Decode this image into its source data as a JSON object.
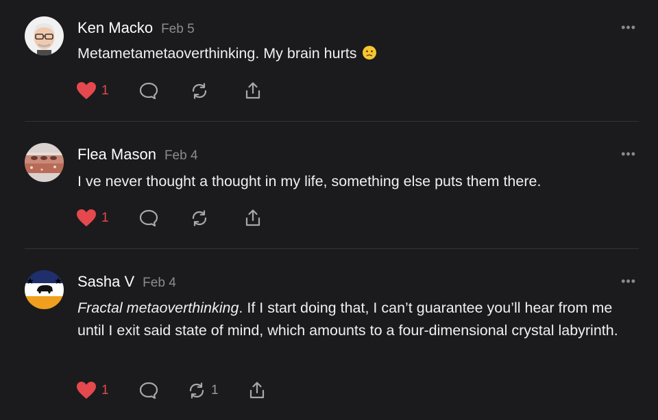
{
  "comments": [
    {
      "author": "Ken Macko",
      "date": "Feb 5",
      "text": "Metametametaoverthinking. My brain hurts",
      "emoji": "🙁",
      "likes": "1",
      "restacks": "",
      "avatar": "cartoon-bald-man-glasses"
    },
    {
      "author": "Flea Mason",
      "date": "Feb 4",
      "text": "I ve never thought a thought in my life, something else puts them there.",
      "likes": "1",
      "restacks": "",
      "avatar": "brick-photo"
    },
    {
      "author": "Sasha V",
      "date": "Feb 4",
      "text_em": "Fractal metaoverthinking",
      "text": ". If I start doing that, I can’t guarantee you’ll hear from me until I exit said state of mind, which amounts to a four-dimensional crystal labyrinth.",
      "likes": "1",
      "restacks": "1",
      "avatar": "bison-flag"
    }
  ],
  "more_label": "•••",
  "colors": {
    "background": "#1b1b1d",
    "like": "#e5484d",
    "muted": "#8c8c90"
  },
  "icons": [
    "heart-icon",
    "comment-icon",
    "restack-icon",
    "share-icon",
    "more-icon"
  ]
}
